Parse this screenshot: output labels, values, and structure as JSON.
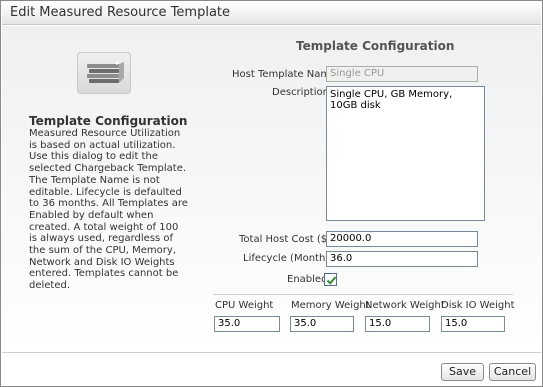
{
  "dialog": {
    "title": "Edit Measured Resource Template"
  },
  "left_panel": {
    "icon": "template-stack-icon",
    "heading": "Template Configuration",
    "description": "Measured Resource Utilization is based on actual utilization. Use this dialog to edit the selected Chargeback Template. The Template Name is not editable. Lifecycle is defaulted to 36 months. All Templates are Enabled by default when created. A total weight of 100 is always used, regardless of the sum of the CPU, Memory, Network and Disk IO Weights entered. Templates cannot be deleted."
  },
  "form": {
    "section_title": "Template Configuration",
    "host_template_name": {
      "label": "Host Template Name",
      "value": "Single CPU"
    },
    "description": {
      "label": "Description",
      "value": "Single CPU, GB Memory, 10GB disk"
    },
    "total_host_cost": {
      "label": "Total Host Cost ($)",
      "value": "20000.0"
    },
    "lifecycle": {
      "label": "Lifecycle (Months)",
      "value": "36.0"
    },
    "enabled": {
      "label": "Enabled",
      "checked": true
    }
  },
  "weights": [
    {
      "label": "CPU Weight",
      "value": "35.0"
    },
    {
      "label": "Memory Weight",
      "value": "35.0"
    },
    {
      "label": "Network Weight",
      "value": "15.0"
    },
    {
      "label": "Disk IO Weight",
      "value": "15.0"
    }
  ],
  "footer": {
    "save_label": "Save",
    "cancel_label": "Cancel"
  },
  "colors": {
    "checkmark": "#2e8b2e",
    "input_border": "#7a8a99",
    "disabled_text": "#999999"
  }
}
